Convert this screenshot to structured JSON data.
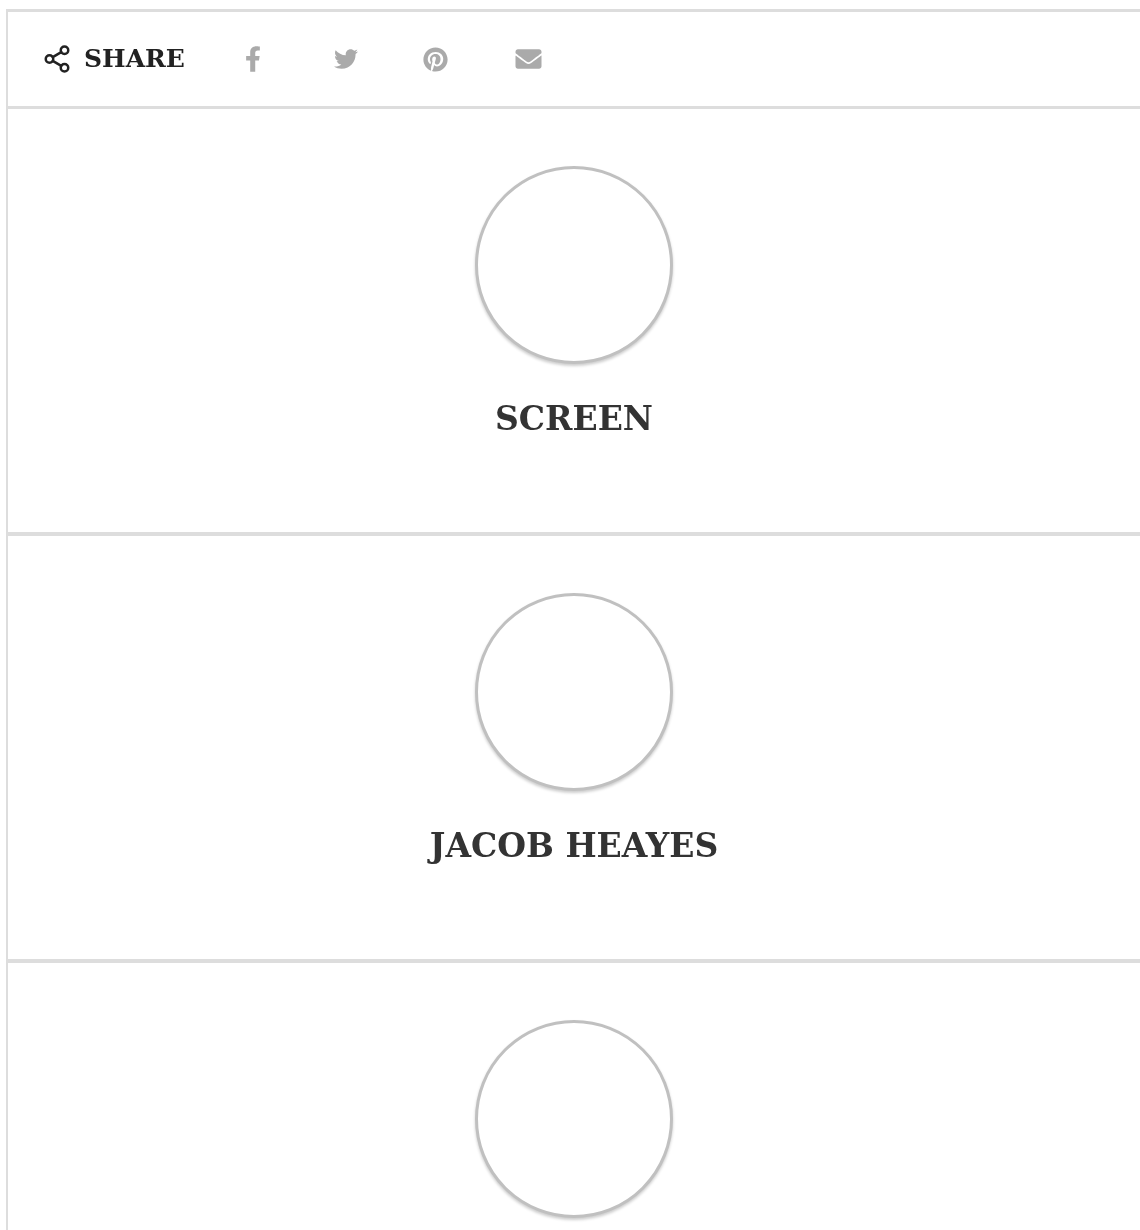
{
  "share_bar": {
    "label": "SHARE"
  },
  "profiles": [
    {
      "kind": "named",
      "name": "SCREEN"
    },
    {
      "kind": "named",
      "name": "JACOB HEAYES"
    },
    {
      "kind": "avatar_only"
    }
  ]
}
